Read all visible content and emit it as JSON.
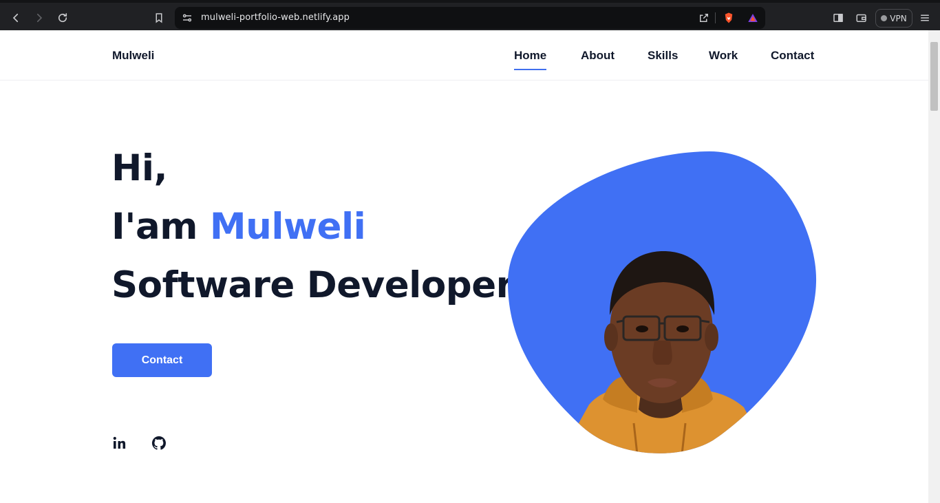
{
  "browser": {
    "url": "mulweli-portfolio-web.netlify.app",
    "vpn_label": "VPN"
  },
  "site": {
    "logo": "Mulweli",
    "nav": [
      {
        "label": "Home",
        "active": true
      },
      {
        "label": "About",
        "active": false
      },
      {
        "label": "Skills",
        "active": false
      },
      {
        "label": "Work",
        "active": false
      },
      {
        "label": "Contact",
        "active": false
      }
    ]
  },
  "hero": {
    "greeting": "Hi,",
    "intro_prefix": "I'am ",
    "name": "Mulweli",
    "role": "Software Developer",
    "cta_label": "Contact"
  },
  "social": [
    "linkedin-icon",
    "github-icon"
  ],
  "colors": {
    "accent": "#4070f4",
    "text_dark": "#10182b",
    "chrome_bg": "#202124"
  }
}
